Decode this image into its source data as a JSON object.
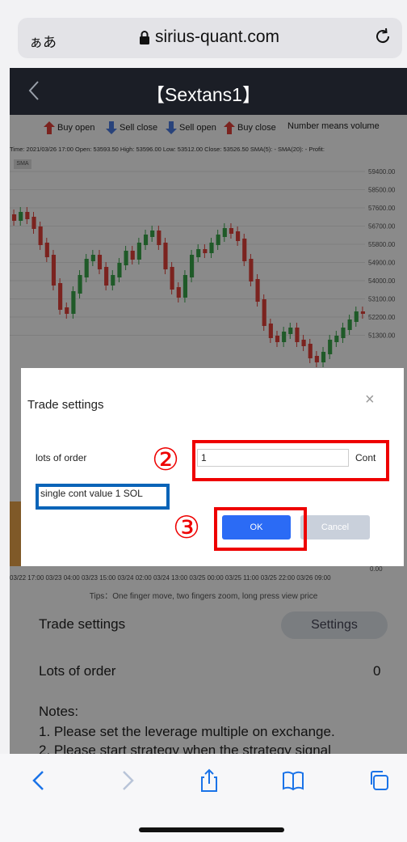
{
  "browser": {
    "aa_label": "ぁあ",
    "url": "sirius-quant.com"
  },
  "app": {
    "title": "【Sextans1】"
  },
  "legend": {
    "buy_open": "Buy open",
    "sell_close": "Sell close",
    "sell_open": "Sell open",
    "buy_close": "Buy close",
    "volume_note": "Number means volume"
  },
  "chart_info": {
    "line": "Time: 2021/03/26 17:00   Open: 53593.50   High: 53596.00   Low: 53512.00   Close: 53526.50   SMA(5): -   SMA(20): -   Profit:",
    "sma_tag": "SMA",
    "y_ticks": [
      "59400.00",
      "58500.00",
      "57600.00",
      "56700.00",
      "55800.00",
      "54900.00",
      "54000.00",
      "53100.00",
      "52200.00",
      "51300.00"
    ],
    "zero_tick": "0.00",
    "x_axis": "03/22 17:00 03/23 04:00 03/23 15:00 03/24 02:00 03/24 13:00 03/25 00:00 03/25 11:00 03/25 22:00 03/26 09:00"
  },
  "page": {
    "tips": "Tips：One finger move, two fingers zoom, long press view price",
    "trade_settings_label": "Trade settings",
    "settings_button": "Settings",
    "lots_of_order_label": "Lots of order",
    "lots_of_order_value": "0",
    "notes_heading": "Notes:",
    "note_1": "1. Please set the leverage multiple on exchange.",
    "note_2": "2. Please start strategy when the strategy signal"
  },
  "modal": {
    "title": "Trade settings",
    "close": "×",
    "lots_label": "lots of order",
    "lots_value": "1",
    "unit": "Cont",
    "single_value": "single cont value 1 SOL",
    "ok": "OK",
    "cancel": "Cancel"
  },
  "annotations": {
    "step2": "②",
    "step3": "③"
  },
  "colors": {
    "ok_button": "#2b6bf5",
    "annotation_red": "#ee0000",
    "annotation_blue": "#0a64b8",
    "candle_up": "#3aa54a",
    "candle_down": "#e0413a"
  }
}
